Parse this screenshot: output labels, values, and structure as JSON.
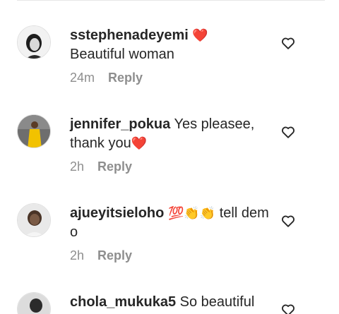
{
  "comments": [
    {
      "username": "sstephenadeyemi",
      "text": "",
      "emoji": "❤️",
      "text2": "Beautiful woman",
      "time": "24m",
      "reply_label": "Reply",
      "avatar_icon": "profile-photo"
    },
    {
      "username": "jennifer_pokua",
      "text": "Yes pleasee, thank you",
      "emoji": "❤️",
      "time": "2h",
      "reply_label": "Reply",
      "avatar_icon": "profile-photo"
    },
    {
      "username": "ajueyitsieloho",
      "emoji": "💯👏👏",
      "text": "tell dem o",
      "time": "2h",
      "reply_label": "Reply",
      "avatar_icon": "profile-photo"
    },
    {
      "username": "chola_mukuka5",
      "text": "So beautiful",
      "avatar_icon": "profile-photo"
    }
  ],
  "colors": {
    "text": "#262626",
    "meta": "#8e8e8e",
    "heart_emoji": "#ed4956"
  },
  "icons": {
    "like": "heart-outline-icon"
  }
}
